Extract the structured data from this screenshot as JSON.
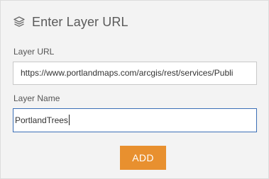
{
  "header": {
    "title": "Enter Layer URL",
    "icon": "layers-icon"
  },
  "form": {
    "url_label": "Layer URL",
    "url_value": "https://www.portlandmaps.com/arcgis/rest/services/Publi",
    "name_label": "Layer Name",
    "name_value": "PortlandTrees",
    "add_label": "ADD"
  },
  "colors": {
    "accent": "#e8902f",
    "focus_border": "#3b6fb6",
    "background": "#f3f3f3"
  }
}
